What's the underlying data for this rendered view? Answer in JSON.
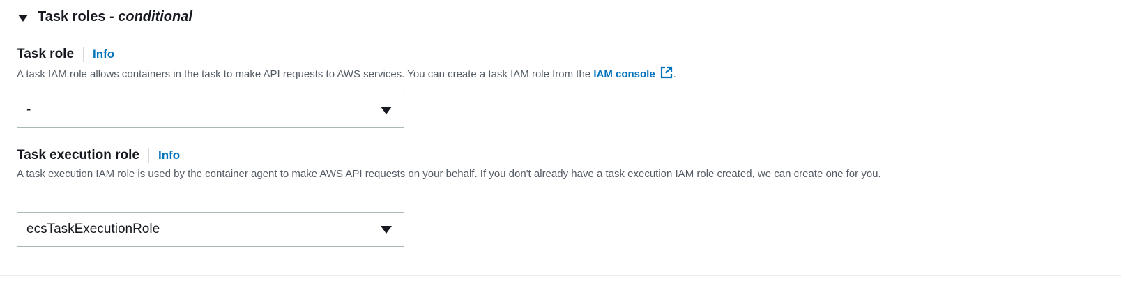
{
  "section": {
    "title": "Task roles -",
    "title_suffix": "conditional"
  },
  "task_role": {
    "label": "Task role",
    "info_label": "Info",
    "description": "A task IAM role allows containers in the task to make API requests to AWS services. You can create a task IAM role from the",
    "link_text": "IAM console",
    "description_end": ".",
    "selected": "-"
  },
  "task_execution_role": {
    "label": "Task execution role",
    "info_label": "Info",
    "description": "A task execution IAM role is used by the container agent to make AWS API requests on your behalf. If you don't already have a task execution IAM role created, we can create one for you.",
    "selected": "ecsTaskExecutionRole"
  },
  "colors": {
    "link": "#0073bb",
    "text": "#16191f",
    "secondary_text": "#545b64",
    "border": "#aab7b8"
  }
}
